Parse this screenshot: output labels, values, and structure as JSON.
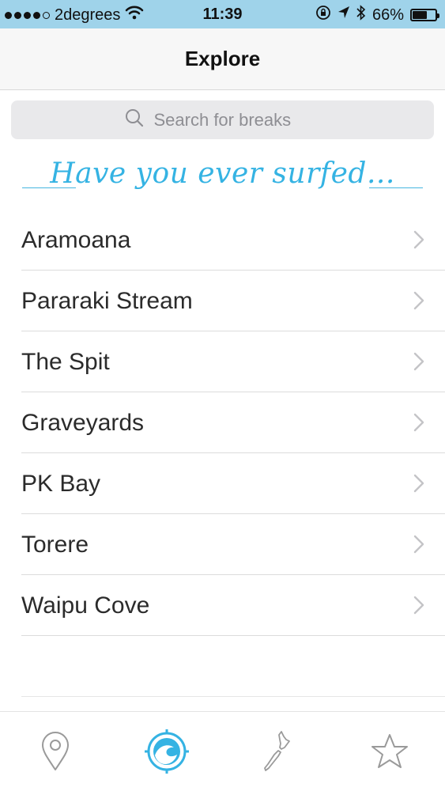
{
  "status_bar": {
    "carrier": "2degrees",
    "time": "11:39",
    "battery": "66%",
    "battery_level": 0.66,
    "icons": [
      "wifi-icon",
      "orientation-lock-icon",
      "location-arrow-icon",
      "bluetooth-icon",
      "battery-icon"
    ]
  },
  "nav": {
    "title": "Explore"
  },
  "search": {
    "placeholder": "Search for breaks",
    "value": ""
  },
  "banner": {
    "text": "Have you ever surfed..."
  },
  "breaks": [
    {
      "name": "Aramoana"
    },
    {
      "name": "Pararaki Stream"
    },
    {
      "name": "The Spit"
    },
    {
      "name": "Graveyards"
    },
    {
      "name": "PK Bay"
    },
    {
      "name": "Torere"
    },
    {
      "name": "Waipu Cove"
    }
  ],
  "tab_bar": {
    "tabs": [
      {
        "icon": "map-pin-icon",
        "active": false
      },
      {
        "icon": "wave-compass-icon",
        "active": true
      },
      {
        "icon": "new-zealand-map-icon",
        "active": false
      },
      {
        "icon": "star-icon",
        "active": false
      }
    ],
    "active_color": "#35b3e3",
    "inactive_color": "#9a9a9a"
  }
}
